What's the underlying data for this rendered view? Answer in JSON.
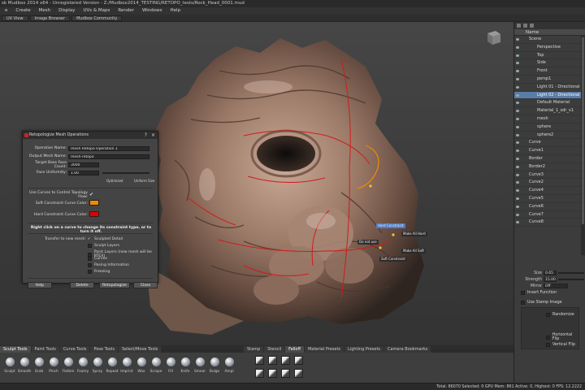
{
  "window": {
    "title": "sk Mudbox 2014 x64 - Unregistered Version - Z:/Mudbox2014_TESTING/RETOPO_tests/Rock_Head_0001.mud"
  },
  "menu": [
    "e",
    "Create",
    "Mesh",
    "Display",
    "UVs & Maps",
    "Render",
    "Windows",
    "Help"
  ],
  "shelf_tabs": [
    "UV View",
    "Image Browser",
    "Mudbox Community"
  ],
  "outliner": {
    "header": "Name",
    "rows": [
      {
        "label": "Scene",
        "indent": 1
      },
      {
        "label": "Perspective",
        "indent": 2
      },
      {
        "label": "Top",
        "indent": 2
      },
      {
        "label": "Side",
        "indent": 2
      },
      {
        "label": "Front",
        "indent": 2
      },
      {
        "label": "persp1",
        "indent": 2
      },
      {
        "label": "Light 01 - Directional",
        "indent": 2
      },
      {
        "label": "Light 02 - Directional",
        "indent": 2,
        "selected": true
      },
      {
        "label": "Default Material",
        "indent": 2
      },
      {
        "label": "Material_1_sdr_v1",
        "indent": 2
      },
      {
        "label": "mesh",
        "indent": 2
      },
      {
        "label": "sphere",
        "indent": 2
      },
      {
        "label": "sphere2",
        "indent": 2
      },
      {
        "label": "Curve",
        "indent": 1
      },
      {
        "label": "Curve1",
        "indent": 1
      },
      {
        "label": "Border",
        "indent": 1
      },
      {
        "label": "Border2",
        "indent": 1
      },
      {
        "label": "Curve3",
        "indent": 1
      },
      {
        "label": "Curve2",
        "indent": 1
      },
      {
        "label": "Curve4",
        "indent": 1
      },
      {
        "label": "Curve5",
        "indent": 1
      },
      {
        "label": "Curve6",
        "indent": 1
      },
      {
        "label": "Curve7",
        "indent": 1
      },
      {
        "label": "Curve8",
        "indent": 1
      }
    ]
  },
  "properties": {
    "size_label": "Size",
    "size_value": "0.65",
    "strength_label": "Strength",
    "strength_value": "15.00",
    "mirror_label": "Mirror",
    "mirror_value": "Off",
    "invert_label": "Invert Function",
    "stamp_label": "Use Stamp Image",
    "randomize_label": "Randomize",
    "horiz_flip_label": "Horizontal Flip",
    "vert_flip_label": "Vertical Flip"
  },
  "dialog": {
    "title": "Retopologize Mesh Operations",
    "operation_name_label": "Operation Name:",
    "operation_name_value": "mesh Retopo Operation 1",
    "output_mesh_label": "Output Mesh Name:",
    "output_mesh_value": "mesh-retopo",
    "target_face_label": "Target Base Face Count:",
    "target_face_value": "3000",
    "face_uniformity_label": "Face Uniformity:",
    "face_uniformity_value": "1.00",
    "optimized_label": "Optimized",
    "uniform_size_label": "Uniform Size",
    "use_curves_label": "Use Curves to Control Topology Flow:",
    "soft_color_label": "Soft Constraint Curve Color:",
    "soft_color": "#f08a00",
    "hard_color_label": "Hard Constraint Curve Color:",
    "hard_color": "#e00000",
    "note": "Right click on a curve to change its constraint type, or to turn it off.",
    "transfer_label": "Transfer to new mesh:",
    "checks": [
      "Sculpted Detail",
      "Sculpt Layers",
      "Paint Layers (new mesh will be PTEX)",
      "Curves",
      "Posing Information",
      "Freezing"
    ],
    "checks_state": [
      true,
      false,
      false,
      false,
      false,
      false
    ],
    "buttons": [
      "Help",
      "Delete",
      "Retopologize",
      "Close"
    ]
  },
  "viewport_labels": {
    "hard_constraint": "Hard Constraint",
    "make_all_hard": "Make All Hard",
    "do_not_use": "Do not use",
    "make_all_soft": "Make All Soft",
    "soft_constraint": "Soft Constraint"
  },
  "bottom_tabs": [
    "Sculpt Tools",
    "Paint Tools",
    "Curve Tools",
    "Pose Tools",
    "Select/Move Tools"
  ],
  "tools": [
    "Sculpt",
    "Smooth",
    "Grab",
    "Pinch",
    "Flatten",
    "Foamy",
    "Spray",
    "Repeat",
    "Imprint",
    "Wax",
    "Scrape",
    "Fill",
    "Knife",
    "Smear",
    "Bulge",
    "Ampl"
  ],
  "stamp_tabs": [
    "Stamp",
    "Stencil",
    "Falloff",
    "Material Presets",
    "Lighting Presets",
    "Camera Bookmarks"
  ],
  "status": {
    "text": "Total: 86070 Selected: 0 GPU Mem: 861 Active: 0, Highest: 0 FPS: 12.2222"
  }
}
